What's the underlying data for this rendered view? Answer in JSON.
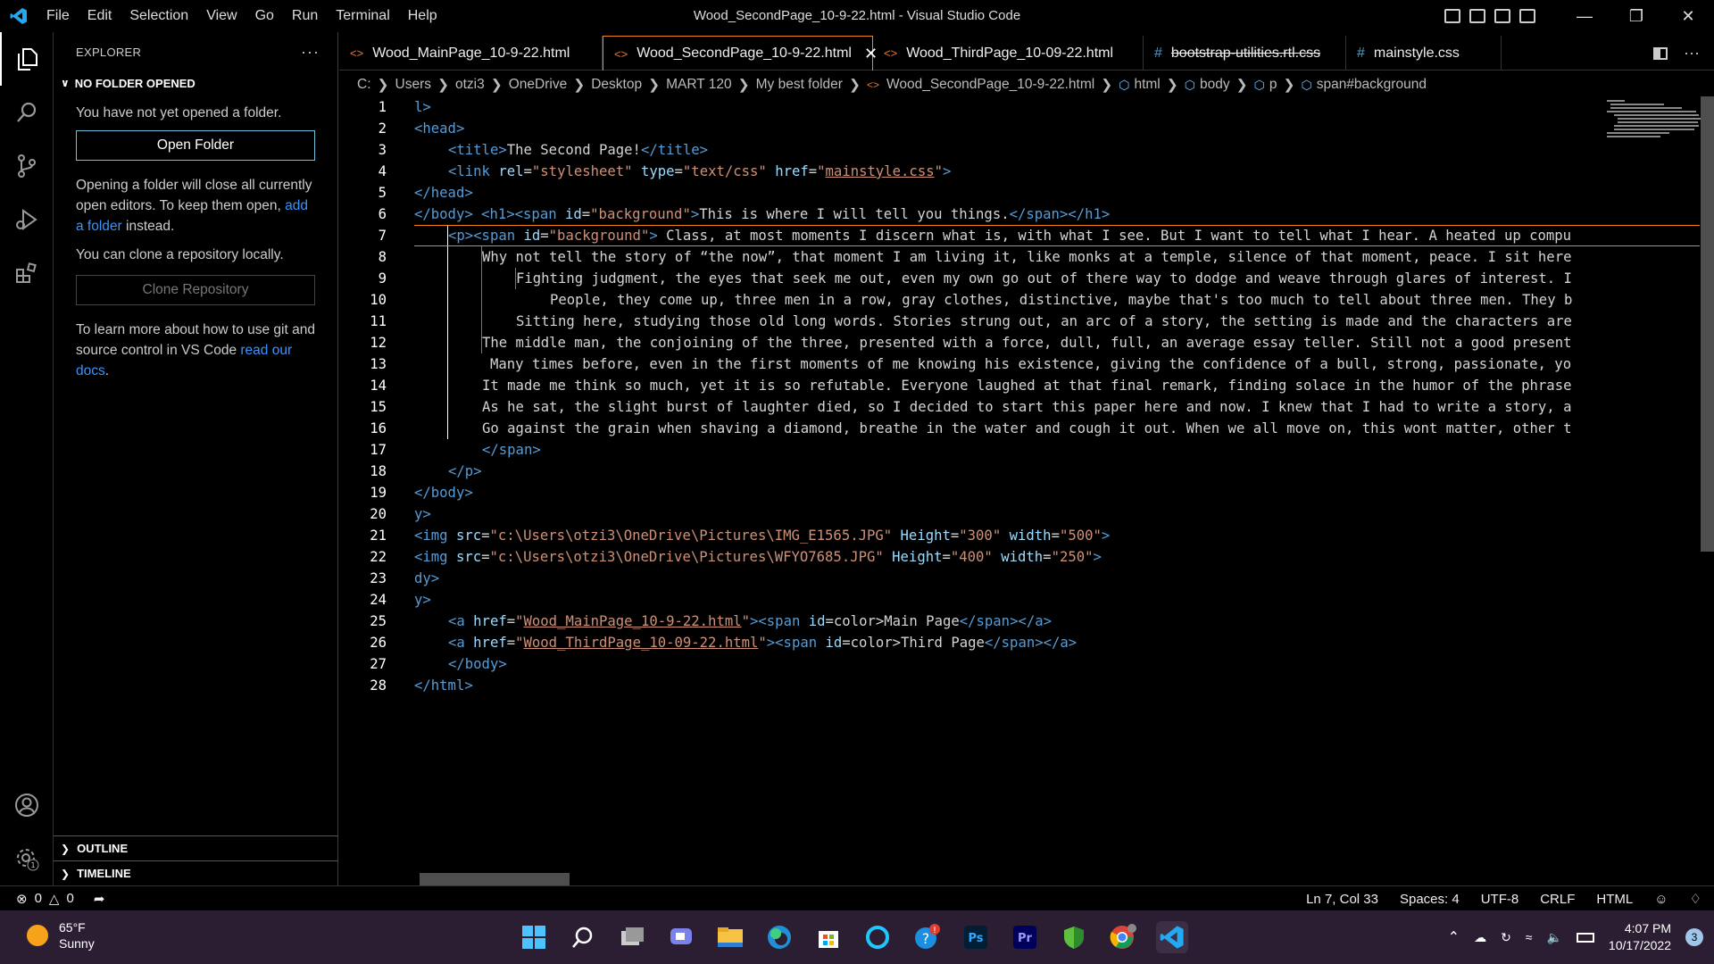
{
  "window": {
    "title": "Wood_SecondPage_10-9-22.html - Visual Studio Code",
    "menu": [
      "File",
      "Edit",
      "Selection",
      "View",
      "Go",
      "Run",
      "Terminal",
      "Help"
    ]
  },
  "sidebar": {
    "title": "EXPLORER",
    "section": "NO FOLDER OPENED",
    "not_opened": "You have not yet opened a folder.",
    "open_folder_button": "Open Folder",
    "opening_text": "Opening a folder will close all currently open editors. To keep them open,",
    "add_folder_link": "add a folder",
    "instead": "instead.",
    "clone_text": "You can clone a repository locally.",
    "clone_button": "Clone Repository",
    "git_text": "To learn more about how to use git and source control in VS Code",
    "docs_link": "read our docs",
    "outline": "OUTLINE",
    "timeline": "TIMELINE"
  },
  "tabs": [
    {
      "label": "Wood_MainPage_10-9-22.html",
      "type": "html",
      "active": false
    },
    {
      "label": "Wood_SecondPage_10-9-22.html",
      "type": "html",
      "active": true
    },
    {
      "label": "Wood_ThirdPage_10-09-22.html",
      "type": "html",
      "active": false
    },
    {
      "label": "bootstrap-utilities.rtl.css",
      "type": "css",
      "active": false,
      "deleted": true
    },
    {
      "label": "mainstyle.css",
      "type": "css",
      "active": false
    }
  ],
  "breadcrumb": {
    "path": [
      "C:",
      "Users",
      "otzi3",
      "OneDrive",
      "Desktop",
      "MART 120",
      "My best folder"
    ],
    "file": "Wood_SecondPage_10-9-22.html",
    "symbols": [
      "html",
      "body",
      "p",
      "span#background"
    ]
  },
  "code": {
    "line_numbers": [
      "1",
      "2",
      "3",
      "4",
      "5",
      "6",
      "7",
      "8",
      "9",
      "10",
      "11",
      "12",
      "13",
      "14",
      "15",
      "16",
      "17",
      "18",
      "19",
      "20",
      "21",
      "22",
      "23",
      "24",
      "25",
      "26",
      "27",
      "28"
    ],
    "l1": "l>",
    "l2": "<head>",
    "l3_title": "The Second Page!",
    "l4_rel": "\"stylesheet\"",
    "l4_type": "\"text/css\"",
    "l4_href": "mainstyle.css",
    "l5": "</head>",
    "l6_id": "\"background\"",
    "l6_text": "This is where I will tell you things.",
    "l7_text": " Class, at most moments I discern what is, with what I see. But I want to tell what I hear. A heated up compu",
    "l8": "Why not tell the story of “the now”, that moment I am living it, like monks at a temple, silence of that moment, peace. I sit here",
    "l9": "Fighting judgment, the eyes that seek me out, even my own go out of there way to dodge and weave through glares of interest. I",
    "l10": "People, they come up, three men in a row, gray clothes, distinctive, maybe that's too much to tell about three men. They b",
    "l11": "Sitting here, studying those old long words. Stories strung out, an arc of a story, the setting is made and the characters are",
    "l12": "The middle man, the conjoining of the three, presented with a force, dull, full, an average essay teller. Still not a good present",
    "l13": "Many times before, even in the first moments of me knowing his existence, giving the confidence of a bull, strong, passionate, yo",
    "l14": "It made me think so much, yet it is so refutable. Everyone laughed at that final remark, finding solace in the humor of the phrase",
    "l15": "As he sat, the slight burst of laughter died, so I decided to start this paper here and now. I knew that I had to write a story, a",
    "l16": "Go against the grain when shaving a diamond, breathe in the water and cough it out. When we all move on, this wont matter, other t",
    "l17": "</span>",
    "l18": "</p>",
    "l19": "</body>",
    "l20": "y>",
    "l21_src": "\"c:\\Users\\otzi3\\OneDrive\\Pictures\\IMG_E1565.JPG\"",
    "l21_h": "\"300\"",
    "l21_w": "\"500\"",
    "l22_src": "\"c:\\Users\\otzi3\\OneDrive\\Pictures\\WFYO7685.JPG\"",
    "l22_h": "\"400\"",
    "l22_w": "\"250\"",
    "l23": "dy>",
    "l24": "y>",
    "l25_href": "Wood_MainPage_10-9-22.html",
    "l25_text": "Main Page",
    "l26_href": "Wood_ThirdPage_10-09-22.html",
    "l26_text": "Third Page",
    "l27": "</body>",
    "l28": "</html>"
  },
  "status": {
    "errors": "0",
    "warnings": "0",
    "position": "Ln 7, Col 33",
    "spaces": "Spaces: 4",
    "encoding": "UTF-8",
    "eol": "CRLF",
    "language": "HTML"
  },
  "taskbar": {
    "temperature": "65°F",
    "condition": "Sunny",
    "time": "4:07 PM",
    "date": "10/17/2022",
    "notifications": "3",
    "apps": [
      "windows-start",
      "search",
      "task-view",
      "teams-chat",
      "file-explorer",
      "edge",
      "microsoft-store",
      "cortana",
      "help",
      "photoshop",
      "premiere",
      "vpn",
      "chrome",
      "vscode"
    ]
  },
  "colors": {
    "accent_border": "#f38518",
    "keyword_tag": "#569cd6",
    "attribute": "#9cdcfe",
    "string": "#ce9178",
    "link": "#3794ff",
    "taskbar_bg": "#2b1e33"
  }
}
